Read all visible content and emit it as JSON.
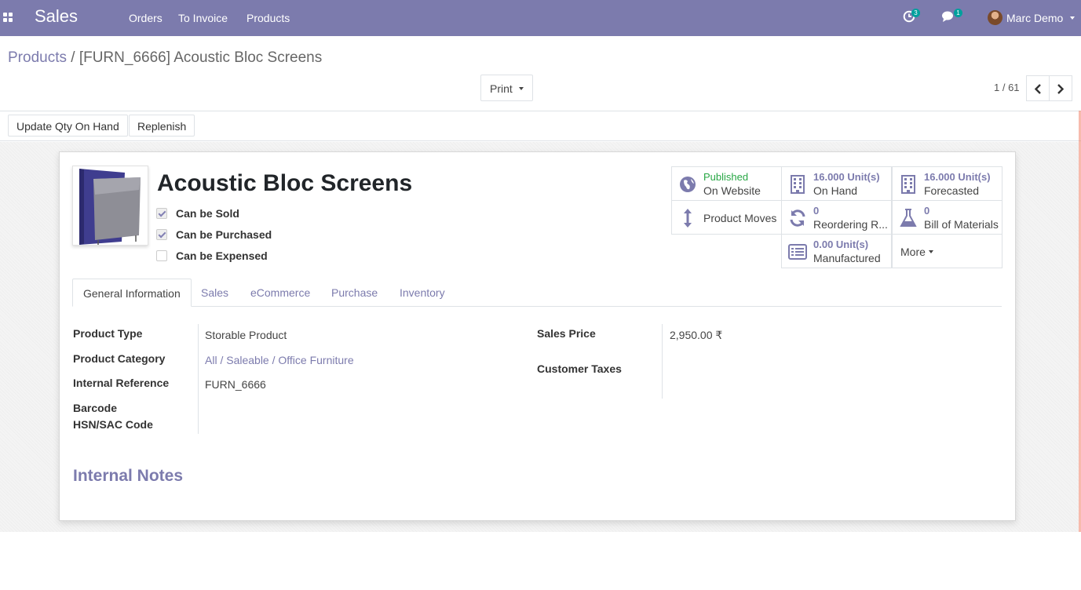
{
  "navbar": {
    "app_name": "Sales",
    "menu": [
      "Orders",
      "To Invoice",
      "Products"
    ],
    "activity_count": "3",
    "message_count": "1",
    "user_name": "Marc Demo"
  },
  "breadcrumb": {
    "parent": "Products",
    "separator": "/",
    "current": "[FURN_6666] Acoustic Bloc Screens"
  },
  "toolbar": {
    "print_label": "Print",
    "pager_value": "1 / 61"
  },
  "statusbar": {
    "update_qty_label": "Update Qty On Hand",
    "replenish_label": "Replenish"
  },
  "product": {
    "name": "Acoustic Bloc Screens",
    "checkboxes": [
      {
        "label": "Can be Sold",
        "checked": true
      },
      {
        "label": "Can be Purchased",
        "checked": true
      },
      {
        "label": "Can be Expensed",
        "checked": false
      }
    ]
  },
  "smart_buttons": {
    "published": {
      "value": "Published",
      "label": "On Website",
      "icon": "globe-icon"
    },
    "on_hand": {
      "value": "16.000 Unit(s)",
      "label": "On Hand",
      "icon": "building-icon"
    },
    "forecasted": {
      "value": "16.000 Unit(s)",
      "label": "Forecasted",
      "icon": "building-icon"
    },
    "product_moves": {
      "label": "Product Moves",
      "icon": "arrows-v-icon"
    },
    "reordering": {
      "value": "0",
      "label": "Reordering R...",
      "icon": "refresh-icon"
    },
    "bom": {
      "value": "0",
      "label": "Bill of Materials",
      "icon": "flask-icon"
    },
    "manufactured": {
      "value": "0.00 Unit(s)",
      "label": "Manufactured",
      "icon": "list-alt-icon"
    },
    "more": {
      "label": "More"
    }
  },
  "tabs": [
    "General Information",
    "Sales",
    "eCommerce",
    "Purchase",
    "Inventory"
  ],
  "general": {
    "product_type_label": "Product Type",
    "product_type": "Storable Product",
    "category_label": "Product Category",
    "category": "All / Saleable / Office Furniture",
    "internal_ref_label": "Internal Reference",
    "internal_ref": "FURN_6666",
    "barcode_label": "Barcode",
    "hsn_label": "HSN/SAC Code",
    "sales_price_label": "Sales Price",
    "sales_price": "2,950.00 ₹",
    "customer_taxes_label": "Customer Taxes"
  },
  "notes": {
    "title": "Internal Notes"
  },
  "colors": {
    "brand": "#7c7bad",
    "published": "#28a745",
    "badge": "#00a09d"
  }
}
